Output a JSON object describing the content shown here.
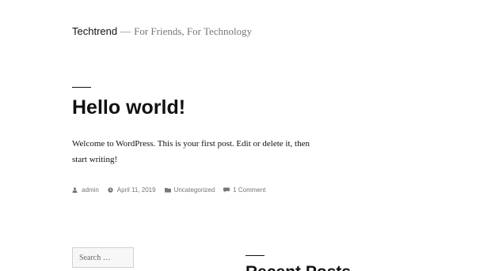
{
  "site": {
    "title": "Techtrend",
    "separator": "—",
    "description": "For Friends, For Technology"
  },
  "post": {
    "title": "Hello world!",
    "content": "Welcome to WordPress. This is your first post. Edit or delete it, then start writing!",
    "meta": {
      "author": "admin",
      "date": "April 11, 2019",
      "category": "Uncategorized",
      "comments": "1 Comment"
    },
    "meta_icons": [
      "user-icon",
      "clock-icon",
      "folder-icon",
      "comment-icon"
    ]
  },
  "sidebar": {
    "search_placeholder": "Search …",
    "recent_posts_title": "Recent Posts"
  },
  "colors": {
    "text": "#111111",
    "muted": "#767676",
    "border": "#d1d1d1",
    "background": "#ffffff"
  }
}
